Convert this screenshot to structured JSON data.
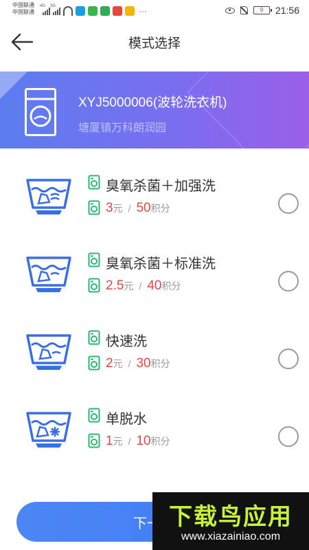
{
  "status_bar": {
    "carrier_1": "中国联通",
    "carrier_2": "中国联通",
    "net_1": "4G",
    "net_2": "3G",
    "battery": "9",
    "time": "21:56",
    "more": "···"
  },
  "header": {
    "title": "模式选择"
  },
  "device": {
    "name": "XYJ5000006(波轮洗衣机)",
    "address": "塘厦镇万科朗润园"
  },
  "modes": [
    {
      "name": "臭氧杀菌＋加强洗",
      "price": "3",
      "price_unit": "元",
      "separator": "/",
      "points": "50",
      "points_unit": "积分",
      "selected": false
    },
    {
      "name": "臭氧杀菌＋标准洗",
      "price": "2.5",
      "price_unit": "元",
      "separator": "/",
      "points": "40",
      "points_unit": "积分",
      "selected": false
    },
    {
      "name": "快速洗",
      "price": "2",
      "price_unit": "元",
      "separator": "/",
      "points": "30",
      "points_unit": "积分",
      "selected": false
    },
    {
      "name": "单脱水",
      "price": "1",
      "price_unit": "元",
      "separator": "/",
      "points": "10",
      "points_unit": "积分",
      "selected": false
    }
  ],
  "footer": {
    "next_label": "下一步"
  },
  "watermark": {
    "logo": "下载鸟应用",
    "url": "www.xiazainiao.com"
  },
  "colors": {
    "accent_blue": "#4c86f5",
    "price_red": "#e04848",
    "banner_start": "#5c7df0",
    "banner_end": "#9b5fe8",
    "icon_green": "#2bb673",
    "tub_blue": "#3a6de8"
  }
}
